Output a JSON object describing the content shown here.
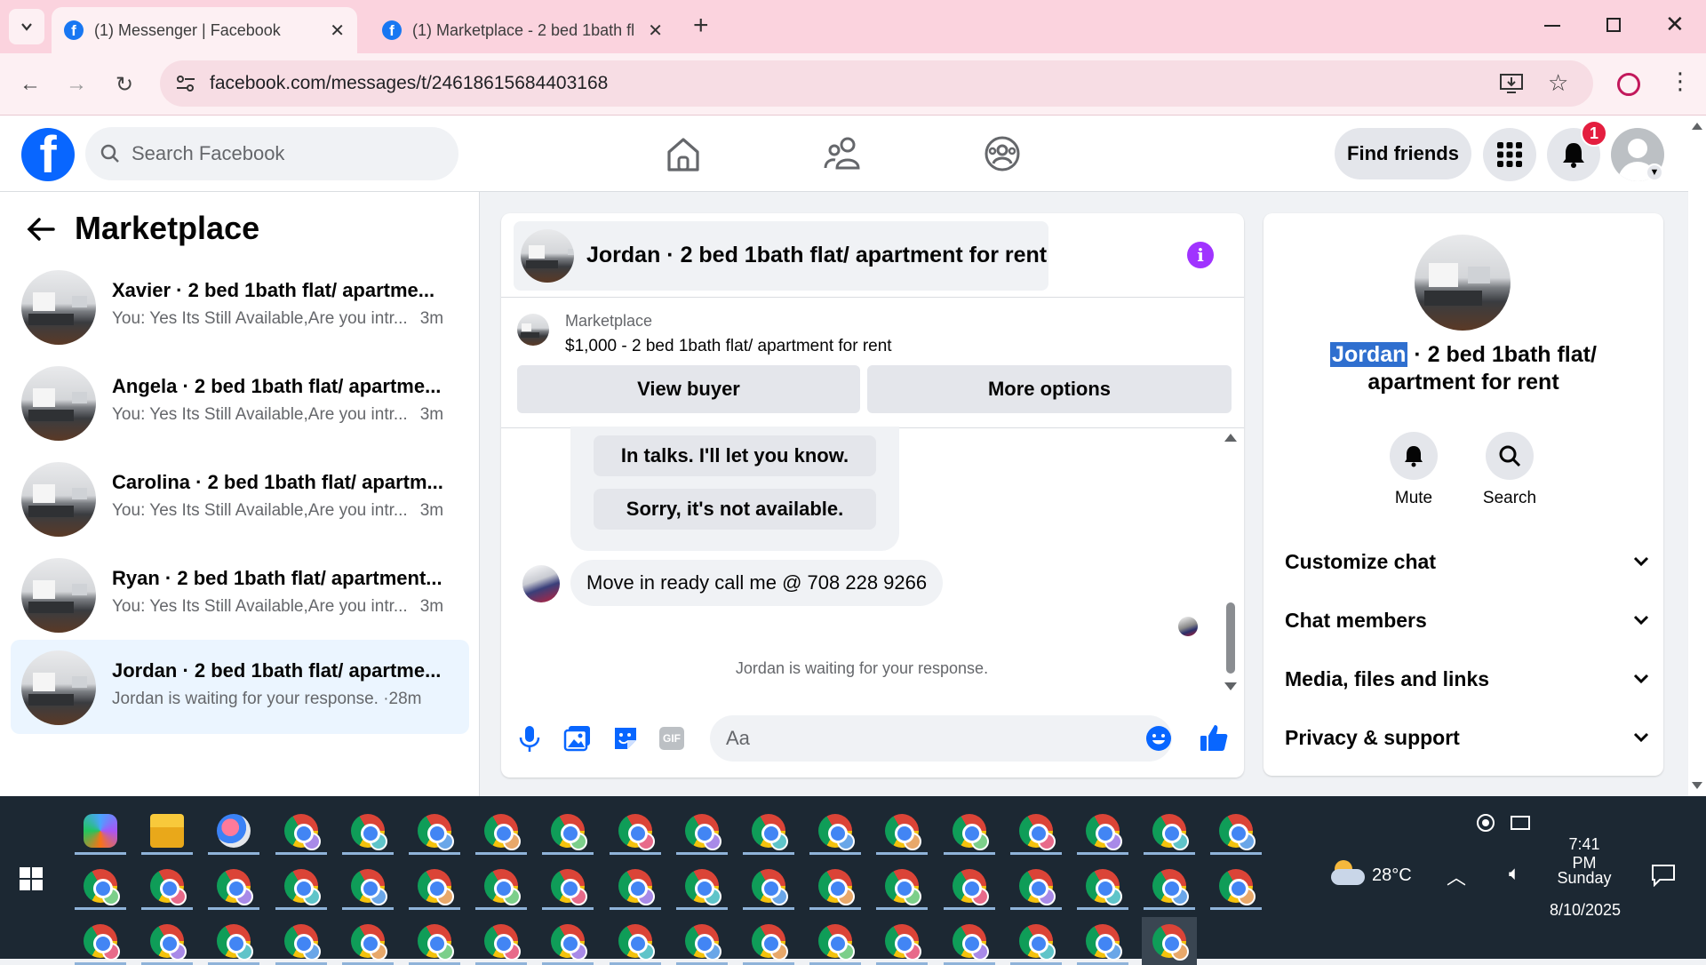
{
  "browser": {
    "tabs": [
      {
        "title": "(1) Messenger | Facebook",
        "active": true
      },
      {
        "title": "(1) Marketplace - 2 bed 1bath fl",
        "active": false
      }
    ],
    "new_tab": "+",
    "url": "facebook.com/messages/t/24618615684403168"
  },
  "header": {
    "search_placeholder": "Search Facebook",
    "find_friends": "Find friends",
    "notification_count": "1"
  },
  "sidebar": {
    "title": "Marketplace",
    "conversations": [
      {
        "name": "Xavier · 2 bed 1bath flat/ apartme...",
        "preview": "You: Yes Its Still Available,Are you intr...",
        "time": "3m",
        "selected": false
      },
      {
        "name": "Angela · 2 bed 1bath flat/ apartme...",
        "preview": "You: Yes Its Still Available,Are you intr...",
        "time": "3m",
        "selected": false
      },
      {
        "name": "Carolina · 2 bed 1bath flat/ apartm...",
        "preview": "You: Yes Its Still Available,Are you intr...",
        "time": "3m",
        "selected": false
      },
      {
        "name": "Ryan · 2 bed 1bath flat/ apartment...",
        "preview": "You: Yes Its Still Available,Are you intr...",
        "time": "3m",
        "selected": false
      },
      {
        "name": "Jordan · 2 bed 1bath flat/ apartme...",
        "preview": "Jordan is waiting for your response. · ",
        "time": "28m",
        "selected": true
      }
    ]
  },
  "chat": {
    "title": "Jordan · 2 bed 1bath flat/ apartment for rent",
    "marketplace_label": "Marketplace",
    "listing": "$1,000 - 2 bed 1bath flat/ apartment for rent",
    "view_buyer": "View buyer",
    "more_options": "More options",
    "suggestions": [
      "In talks. I'll let you know.",
      "Sorry, it's not available."
    ],
    "message": "Move in ready call me @ 708 228 9266",
    "waiting": "Jordan is waiting for your response.",
    "composer_placeholder": "Aa"
  },
  "info_panel": {
    "name_highlight": "Jordan",
    "name_rest": " · 2 bed 1bath flat/",
    "name_line2": "apartment for rent",
    "mute": "Mute",
    "search": "Search",
    "sections": [
      "Customize chat",
      "Chat members",
      "Media, files and links",
      "Privacy & support"
    ]
  },
  "taskbar": {
    "temperature": "28°C",
    "time": "7:41 PM",
    "day": "Sunday",
    "date": "8/10/2025"
  },
  "colors": {
    "tab_strip": "#fbd3de",
    "fb_blue": "#0866ff",
    "selected_conv": "#ebf5ff",
    "info_purple": "#a033ff",
    "taskbar": "#1c2833"
  }
}
